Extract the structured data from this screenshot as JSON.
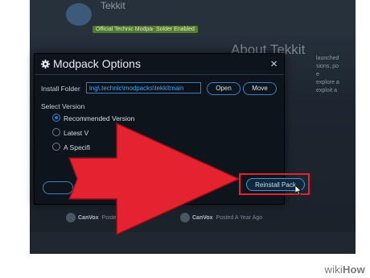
{
  "background": {
    "pack_name": "Tekkit",
    "badges": [
      "Official Technic Modpack",
      "Solder Enabled"
    ],
    "about_heading": "About Tekkit",
    "side_text": [
      "launched",
      "sions, po",
      "e",
      "explore a",
      "exploit a"
    ],
    "users": [
      {
        "name": "CanVox",
        "time": "Posted A Year Ago"
      },
      {
        "name": "CanVox",
        "time": "Posted A Year Ago"
      }
    ]
  },
  "modal": {
    "title": "Modpack Options",
    "close_label": "×",
    "install_folder_label": "Install Folder",
    "install_folder_value": "ing\\.technic\\modpacks\\tekkitmain",
    "open_label": "Open",
    "move_label": "Move",
    "select_version_label": "Select Version",
    "options": [
      {
        "label": "Recommended Version",
        "selected": true
      },
      {
        "label": "Latest V",
        "selected": false
      },
      {
        "label": "A Specifi",
        "selected": false
      }
    ],
    "reinstall_label": "Reinstall Pack"
  },
  "watermark": {
    "part1": "wiki",
    "part2": "How"
  },
  "colors": {
    "arrow_red": "#e5222f",
    "accent_blue": "#3d7cc0",
    "modal_bg": "#0d141b"
  },
  "icons": [
    "gear-icon",
    "close-icon",
    "arrow-annotation",
    "mouse-cursor-icon"
  ]
}
